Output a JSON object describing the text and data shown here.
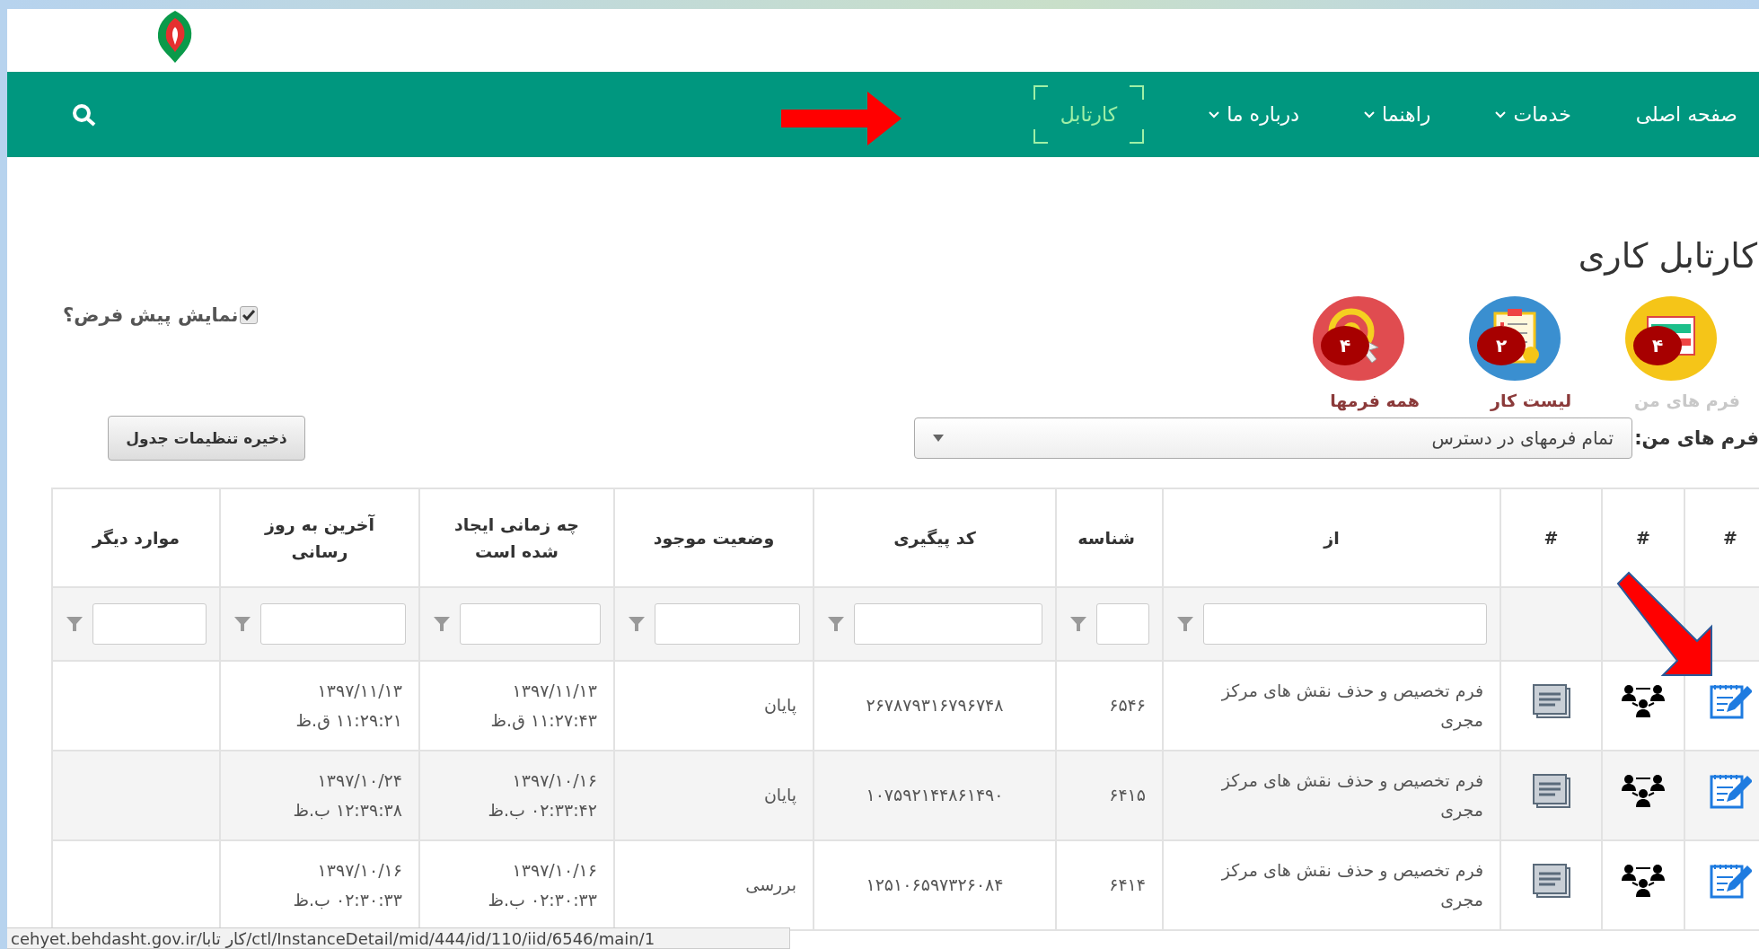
{
  "nav": {
    "items": [
      {
        "label": "صفحه اصلی",
        "has_menu": false,
        "selected": false
      },
      {
        "label": "خدمات",
        "has_menu": true,
        "selected": false
      },
      {
        "label": "راهنما",
        "has_menu": true,
        "selected": false
      },
      {
        "label": "درباره ما",
        "has_menu": true,
        "selected": false
      },
      {
        "label": "کارتابل",
        "has_menu": false,
        "selected": true
      }
    ]
  },
  "page_title": "کارتابل کاری",
  "shortcuts": [
    {
      "label": "فرم های من",
      "count": "۴",
      "color": "#f5c518",
      "kind": "form",
      "selected": true
    },
    {
      "label": "لیست کار",
      "count": "۲",
      "color": "#3a8fd0",
      "kind": "checklist",
      "selected": false
    },
    {
      "label": "همه فرمها",
      "count": "۴",
      "color": "#e04c50",
      "kind": "target",
      "selected": false
    }
  ],
  "default_view": {
    "label": "نمایش پیش فرض؟",
    "checked": true
  },
  "form_filter": {
    "label": "فرم های من:",
    "value": "تمام فرمهای در دسترس"
  },
  "save_button": "ذخیره تنظیمات جدول",
  "table": {
    "columns": [
      {
        "label": "#",
        "filterable": false
      },
      {
        "label": "#",
        "filterable": false
      },
      {
        "label": "#",
        "filterable": false
      },
      {
        "label": "از",
        "filterable": true
      },
      {
        "label": "شناسه",
        "filterable": true
      },
      {
        "label": "کد پیگیری",
        "filterable": true
      },
      {
        "label": "وضعیت موجود",
        "filterable": true
      },
      {
        "label": "چه زمانی ایجاد شده است",
        "filterable": true
      },
      {
        "label": "آخرین به روز رسانی",
        "filterable": true
      },
      {
        "label": "موارد دیگر",
        "filterable": true
      }
    ],
    "rows": [
      {
        "from": "فرم تخصیص و حذف نقش های مرکز مجری",
        "id": "۶۵۴۶",
        "tracking_code": "۲۶۷۸۷۹۳۱۶۷۹۶۷۴۸",
        "status": "پایان",
        "created_date": "۱۳۹۷/۱۱/۱۳",
        "created_time": "۱۱:۲۷:۴۳ ق.ظ",
        "updated_date": "۱۳۹۷/۱۱/۱۳",
        "updated_time": "۱۱:۲۹:۲۱ ق.ظ"
      },
      {
        "from": "فرم تخصیص و حذف نقش های مرکز مجری",
        "id": "۶۴۱۵",
        "tracking_code": "۱۰۷۵۹۲۱۴۴۸۶۱۴۹۰",
        "status": "پایان",
        "created_date": "۱۳۹۷/۱۰/۱۶",
        "created_time": "۰۲:۳۳:۴۲ ب.ظ",
        "updated_date": "۱۳۹۷/۱۰/۲۴",
        "updated_time": "۱۲:۳۹:۳۸ ب.ظ"
      },
      {
        "from": "فرم تخصیص و حذف نقش های مرکز مجری",
        "id": "۶۴۱۴",
        "tracking_code": "۱۲۵۱۰۶۵۹۷۳۲۶۰۸۴",
        "status": "بررسی",
        "created_date": "۱۳۹۷/۱۰/۱۶",
        "created_time": "۰۲:۳۰:۳۳ ب.ظ",
        "updated_date": "۱۳۹۷/۱۰/۱۶",
        "updated_time": "۰۲:۳۰:۳۳ ب.ظ"
      }
    ]
  },
  "status_bar": {
    "url": "cehyet.behdasht.gov.ir/کار تابا/ctl/InstanceDetail/mid/444/id/110/iid/6546/main/1"
  }
}
